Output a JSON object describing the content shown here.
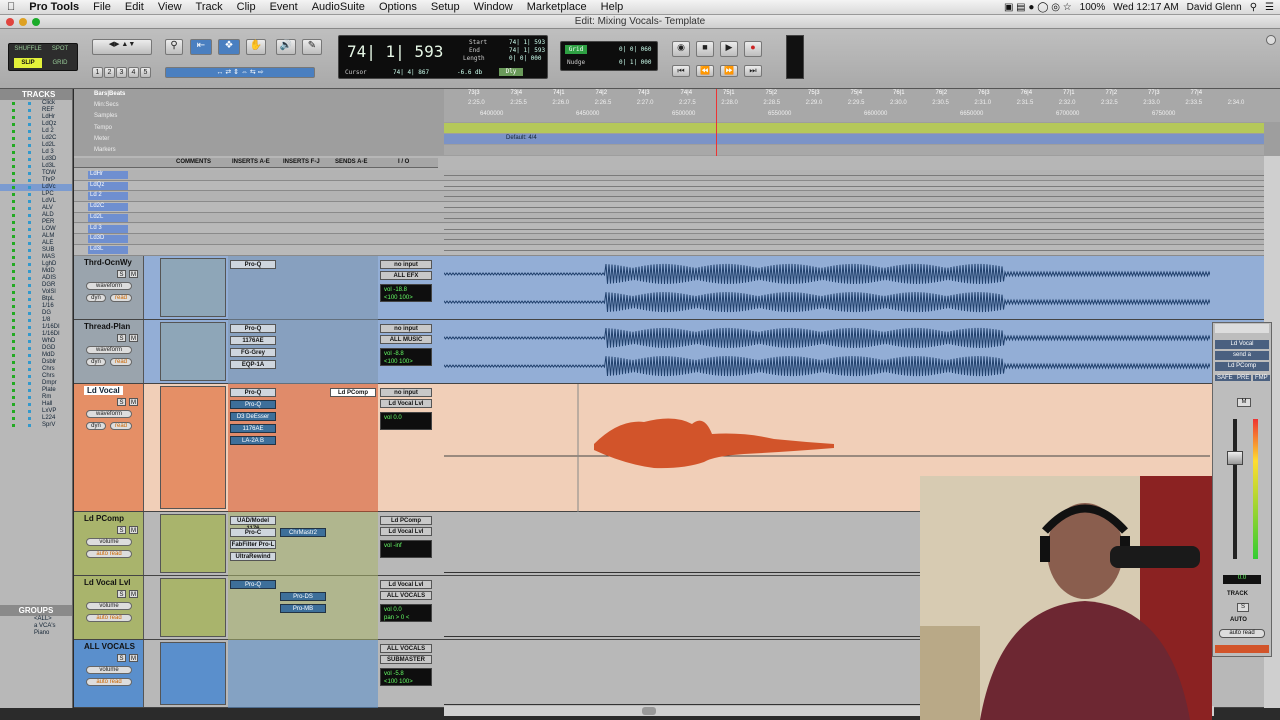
{
  "menubar": {
    "apple": "",
    "app": "Pro Tools",
    "items": [
      "File",
      "Edit",
      "View",
      "Track",
      "Clip",
      "Event",
      "AudioSuite",
      "Options",
      "Setup",
      "Window",
      "Marketplace",
      "Help"
    ],
    "battery": "100%",
    "clock": "Wed 12:17 AM",
    "user": "David Glenn"
  },
  "window": {
    "title": "Edit: Mixing Vocals- Template"
  },
  "toolbar": {
    "mode_shuffle": "SHUFFLE",
    "mode_spot": "SPOT",
    "mode_slip": "SLIP",
    "mode_grid": "GRID",
    "zoom_presets": [
      "1",
      "2",
      "3",
      "4",
      "5"
    ],
    "main_counter": "74| 1| 593",
    "start_label": "Start",
    "end_label": "End",
    "length_label": "Length",
    "start_value": "74| 1| 593",
    "end_value": "74| 1| 593",
    "length_value": "0| 0| 000",
    "cursor_label": "Cursor",
    "cursor_value": "74| 4| 867",
    "cursor_db": "-6.6 db",
    "dly": "Dly",
    "grid_label": "Grid",
    "grid_value": "0| 0| 060",
    "nudge_label": "Nudge",
    "nudge_value": "0| 1| 000"
  },
  "tracks_panel": {
    "title": "TRACKS",
    "items": [
      "Click",
      "REF",
      "LdHr",
      "LdQz",
      "Ld 2",
      "Ld2C",
      "Ld2L",
      "Ld 3",
      "Ld3D",
      "Ld3L",
      "TOW",
      "ThrP",
      "LdVc",
      "LPC",
      "LdVL",
      "ALV",
      "ALD",
      "PER",
      "LOW",
      "ALM",
      "ALE",
      "SUB",
      "MAS",
      "LghD",
      "MdD",
      "ADIS",
      "DGR",
      "VolSl",
      "BtpL",
      "1/16",
      "DG",
      "1/8",
      "1/16DI",
      "1/16DI",
      "WhD",
      "DGD",
      "MdD",
      "Dsblr",
      "Chrs",
      "Chrs",
      "Dmpr",
      "Plate",
      "Rm",
      "Hall",
      "LxVP",
      "L224",
      "SprV"
    ]
  },
  "groups_panel": {
    "title": "GROUPS",
    "items": [
      "<ALL>",
      "a VCA's",
      "Piano"
    ]
  },
  "rulers": {
    "labels": [
      "Bars|Beats",
      "Min:Secs",
      "Samples",
      "Tempo",
      "Meter",
      "Markers"
    ],
    "meter_value": "Default: 4/4",
    "bars": [
      "73|3",
      "73|4",
      "74|1",
      "74|2",
      "74|3",
      "74|4",
      "75|1",
      "75|2",
      "75|3",
      "75|4",
      "76|1",
      "76|2",
      "76|3",
      "76|4",
      "77|1",
      "77|2",
      "77|3",
      "77|4"
    ],
    "times": [
      "2:25.0",
      "2:25.5",
      "2:26.0",
      "2:26.5",
      "2:27.0",
      "2:27.5",
      "2:28.0",
      "2:28.5",
      "2:29.0",
      "2:29.5",
      "2:30.0",
      "2:30.5",
      "2:31.0",
      "2:31.5",
      "2:32.0",
      "2:32.5",
      "2:33.0",
      "2:33.5",
      "2:34.0"
    ],
    "samples": [
      "6400000",
      "6450000",
      "6500000",
      "6550000",
      "6600000",
      "6650000",
      "6700000",
      "6750000"
    ]
  },
  "column_headers": {
    "comments": "COMMENTS",
    "inserts_ae": "INSERTS A-E",
    "inserts_fj": "INSERTS F-J",
    "sends_ae": "SENDS A-E",
    "io": "I / O"
  },
  "small_tracks": [
    "LdHr",
    "LdQz",
    "Ld 2",
    "Ld2C",
    "Ld2L",
    "Ld 3",
    "Ld3D",
    "Ld3L"
  ],
  "tracks": [
    {
      "name": "Thrd-OcnWy",
      "view": "waveform",
      "dyn": "dyn",
      "auto": "read",
      "inserts": [
        "Pro-Q"
      ],
      "inserts2": [],
      "sends": [],
      "io_in": "no input",
      "io_out": "ALL EFX",
      "vol": "vol -18.8",
      "pan": "<100 100>"
    },
    {
      "name": "Thread-Plan",
      "view": "waveform",
      "dyn": "dyn",
      "auto": "read",
      "inserts": [
        "Pro-Q",
        "1176AE",
        "FG-Grey",
        "EQP-1A"
      ],
      "inserts2": [],
      "sends": [],
      "io_in": "no input",
      "io_out": "ALL MUSIC",
      "vol": "vol -8.8",
      "pan": "<100 100>"
    },
    {
      "name": "Ld Vocal",
      "view": "waveform",
      "dyn": "dyn",
      "auto": "read",
      "inserts": [
        "Pro-Q",
        "Pro-Q",
        "D3 DeEsser",
        "1176AE",
        "LA-2A B"
      ],
      "inserts2": [],
      "sends": [
        "Ld PComp"
      ],
      "io_in": "no input",
      "io_out": "Ld Vocal Lvl",
      "vol": "vol 0.0",
      "pan": ""
    },
    {
      "name": "Ld PComp",
      "view": "volume",
      "dyn": "",
      "auto": "auto read",
      "inserts": [
        "UAD/Model 1176",
        "Pro-C",
        "FabFilter Pro-L",
        "UltraRewind"
      ],
      "inserts2": [
        "ChrMastr2"
      ],
      "sends": [],
      "io_in": "Ld PComp",
      "io_out": "Ld Vocal Lvl",
      "vol": "vol -inf",
      "pan": ""
    },
    {
      "name": "Ld Vocal Lvl",
      "view": "volume",
      "dyn": "",
      "auto": "auto read",
      "inserts": [
        "Pro-Q"
      ],
      "inserts2": [
        "Pro-DS",
        "Pro-MB"
      ],
      "sends": [],
      "io_in": "Ld Vocal Lvl",
      "io_out": "ALL VOCALS",
      "vol": "vol 0.0",
      "pan": "pan > 0 <"
    },
    {
      "name": "ALL VOCALS",
      "view": "volume",
      "dyn": "",
      "auto": "auto read",
      "inserts": [],
      "inserts2": [],
      "sends": [],
      "io_in": "ALL VOCALS",
      "io_out": "SUBMASTER",
      "vol": "vol -5.8",
      "pan": "<100 100>"
    }
  ],
  "right_panel": {
    "name": "Ld Vocal",
    "send": "send a",
    "dest": "Ld PComp",
    "safe": "SAFE",
    "pre": "PRE",
    "fmp": "FMP",
    "m": "M",
    "level": "0.0",
    "track": "TRACK",
    "s": "S",
    "auto": "AUTO",
    "auto_mode": "auto read"
  },
  "colors": {
    "vocal": "#d2542a",
    "vocal_bg": "#f1cfb8",
    "blue_track": "#93aed6",
    "blue_wave": "#1f3f6b",
    "green_strip": "#a9b46c"
  }
}
